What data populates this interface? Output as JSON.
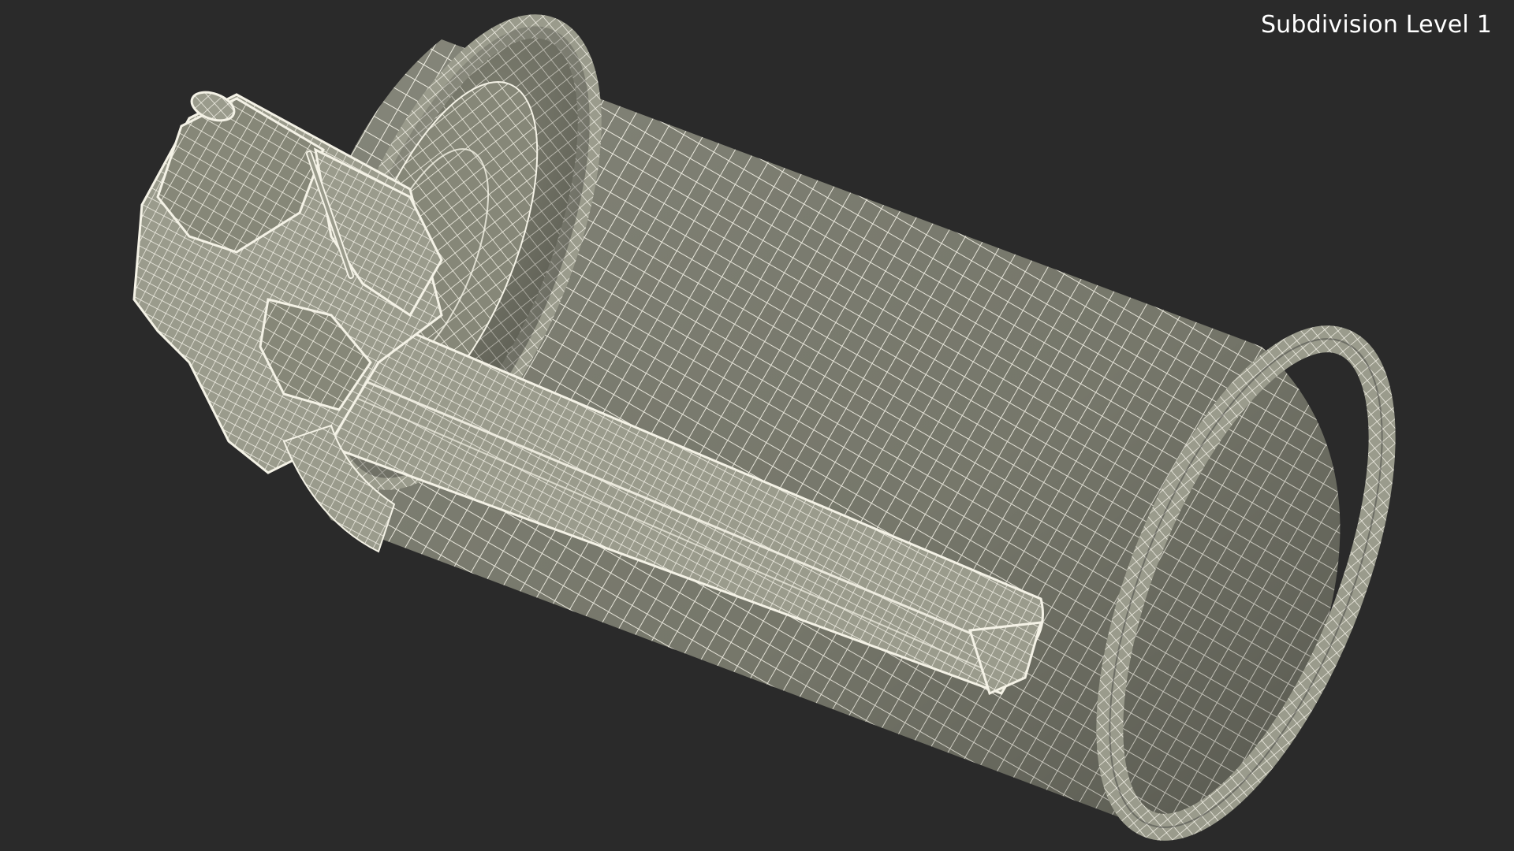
{
  "viewport": {
    "label": "Subdivision Level 1"
  },
  "colors": {
    "background": "#2a2a2a",
    "surface": "#7c7d70",
    "wire": "#f4f2e6"
  },
  "icons": {
    "object": "grenade-canister-wireframe"
  }
}
